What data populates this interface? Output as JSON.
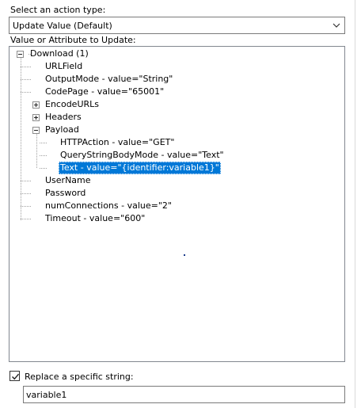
{
  "action_type": {
    "label": "Select an action type:",
    "selected": "Update Value (Default)"
  },
  "tree": {
    "label": "Value or Attribute to Update:",
    "nodes": [
      "Download (1)",
      "URLField",
      "OutputMode - value=\"String\"",
      "CodePage - value=\"65001\"",
      "EncodeURLs",
      "Headers",
      "Payload",
      "HTTPAction - value=\"GET\"",
      "QueryStringBodyMode - value=\"Text\"",
      "Text - value=\"{identifier:variable1}\"",
      "UserName",
      "Password",
      "numConnections - value=\"2\"",
      "Timeout - value=\"600\""
    ],
    "selected_node": "Text - value=\"{identifier:variable1}\""
  },
  "replace": {
    "checked": true,
    "label": "Replace a specific string:",
    "value": "variable1"
  },
  "colors": {
    "selection": "#0078d7",
    "border": "#7a7a7a"
  }
}
